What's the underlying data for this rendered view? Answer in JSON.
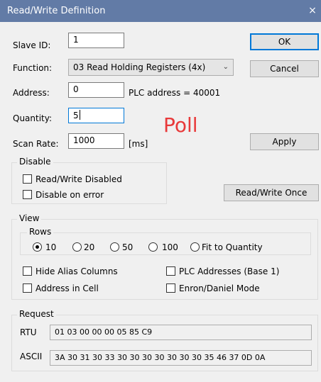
{
  "window": {
    "title": "Read/Write Definition",
    "close_glyph": "×"
  },
  "form": {
    "slave_id": {
      "label": "Slave ID:",
      "value": "1"
    },
    "function": {
      "label": "Function:",
      "value": "03 Read Holding Registers (4x)"
    },
    "address": {
      "label": "Address:",
      "value": "0",
      "plc_address": "PLC address = 40001"
    },
    "quantity": {
      "label": "Quantity:",
      "value": "5"
    },
    "scan_rate": {
      "label": "Scan Rate:",
      "value": "1000",
      "unit": "[ms]"
    },
    "mode_text": "Poll"
  },
  "buttons": {
    "ok": "OK",
    "cancel": "Cancel",
    "apply": "Apply",
    "read_write_once": "Read/Write Once"
  },
  "disable": {
    "title": "Disable",
    "read_write_disabled": {
      "label": "Read/Write Disabled",
      "checked": false
    },
    "disable_on_error": {
      "label": "Disable on error",
      "checked": false
    }
  },
  "view": {
    "title": "View",
    "rows": {
      "title": "Rows",
      "options": [
        "10",
        "20",
        "50",
        "100",
        "Fit to Quantity"
      ],
      "selected": "10"
    },
    "hide_alias_columns": {
      "label": "Hide Alias Columns",
      "checked": false
    },
    "address_in_cell": {
      "label": "Address in Cell",
      "checked": false
    },
    "plc_addresses_base1": {
      "label": "PLC Addresses (Base 1)",
      "checked": false
    },
    "enron_daniel_mode": {
      "label": "Enron/Daniel Mode",
      "checked": false
    }
  },
  "request": {
    "title": "Request",
    "rtu_label": "RTU",
    "rtu_value": "01 03 00 00 00 05 85 C9",
    "ascii_label": "ASCII",
    "ascii_value": "3A 30 31 30 33 30 30 30 30 30 30 30 35 46 37 0D 0A"
  },
  "colors": {
    "titlebar": "#627ba6",
    "focus_border": "#0078d7",
    "poll_text": "#e8393a"
  }
}
